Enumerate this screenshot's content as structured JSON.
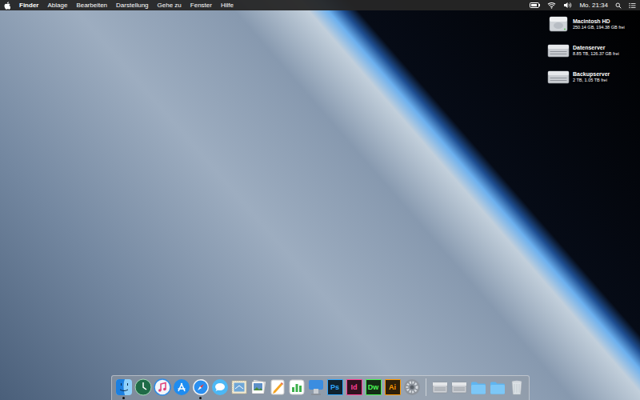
{
  "menu_bar": {
    "app": "Finder",
    "items": [
      "Ablage",
      "Bearbeiten",
      "Darstellung",
      "Gehe zu",
      "Fenster",
      "Hilfe"
    ],
    "battery": {
      "level": 0.85
    },
    "clock": "Mo. 21:34"
  },
  "desktop_icons": [
    {
      "name": "Macintosh HD",
      "info": "250.14 GB, 194.38 GB frei",
      "kind": "hd"
    },
    {
      "name": "Datenserver",
      "info": "8.85 TB, 126.37 GB frei",
      "kind": "server"
    },
    {
      "name": "Backupserver",
      "info": "2 TB, 1.05 TB frei",
      "kind": "server"
    }
  ],
  "dock": {
    "apps": [
      {
        "kind": "finder",
        "running": true
      },
      {
        "kind": "timemachine",
        "running": false
      },
      {
        "kind": "itunes",
        "running": false
      },
      {
        "kind": "appstore",
        "running": false
      },
      {
        "kind": "safari",
        "running": true
      },
      {
        "kind": "messages",
        "running": false
      },
      {
        "kind": "mail",
        "running": false
      },
      {
        "kind": "preview",
        "running": false
      },
      {
        "kind": "pages",
        "running": false
      },
      {
        "kind": "numbers",
        "running": false
      },
      {
        "kind": "keynote",
        "running": false
      },
      {
        "kind": "adobe",
        "label": "Ps",
        "color": "#31a8ff",
        "running": false
      },
      {
        "kind": "adobe",
        "label": "Id",
        "color": "#ff3f94",
        "running": false
      },
      {
        "kind": "adobe",
        "label": "Dw",
        "color": "#4af254",
        "running": false
      },
      {
        "kind": "adobe",
        "label": "Ai",
        "color": "#ff9a00",
        "running": false
      },
      {
        "kind": "sysprefs",
        "running": false
      }
    ],
    "others": [
      {
        "kind": "server"
      },
      {
        "kind": "server"
      },
      {
        "kind": "folder"
      },
      {
        "kind": "folder"
      },
      {
        "kind": "trash"
      }
    ]
  }
}
